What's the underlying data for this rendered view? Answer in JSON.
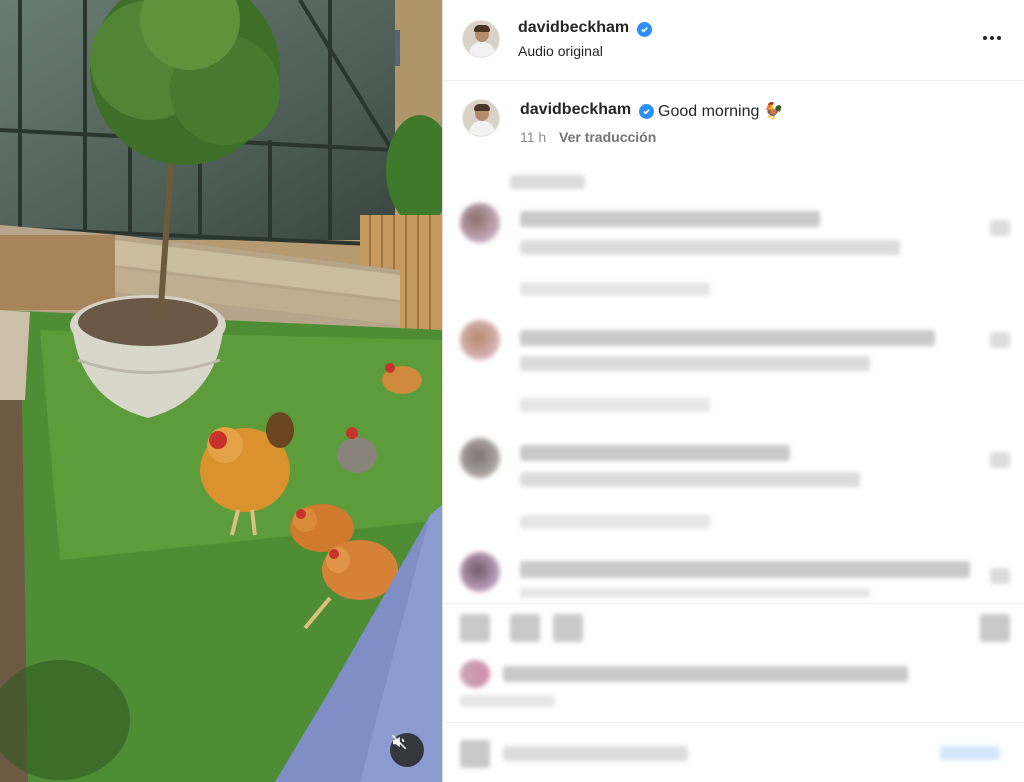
{
  "post": {
    "username": "davidbeckham",
    "audio_label": "Audio original",
    "caption": "Good morning",
    "caption_emoji": "🐓",
    "time_ago": "11 h",
    "translate_label": "Ver traducción"
  },
  "icons": {
    "verified": "verified-badge-icon",
    "more": "more-options-icon",
    "mute": "speaker-muted-icon"
  },
  "colors": {
    "verified_blue": "#2b8ff5",
    "text": "#262626",
    "muted_text": "#8e8e8e",
    "divider": "#dbdbdb"
  }
}
